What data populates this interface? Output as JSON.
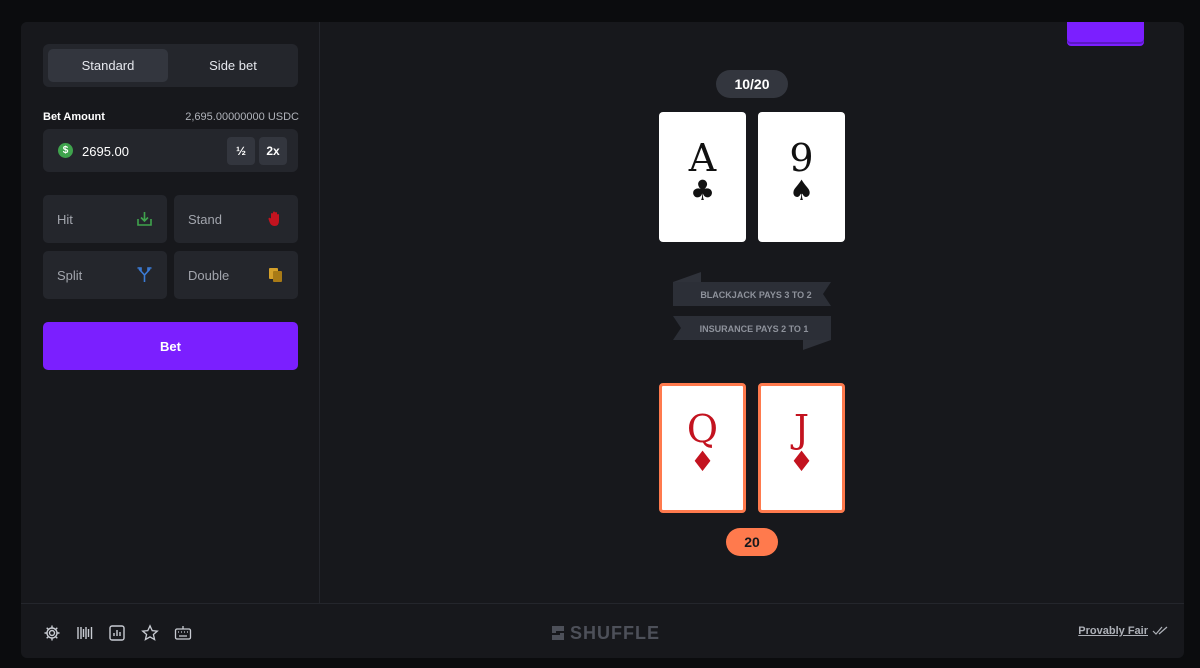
{
  "tabs": {
    "standard": "Standard",
    "side_bet": "Side bet"
  },
  "bet": {
    "label": "Bet Amount",
    "balance": "2,695.00000000 USDC",
    "coin_symbol": "$",
    "value": "2695.00",
    "half": "½",
    "double": "2x"
  },
  "actions": {
    "hit": "Hit",
    "stand": "Stand",
    "split": "Split",
    "double": "Double"
  },
  "bet_button": "Bet",
  "dealer": {
    "score": "10/20",
    "cards": [
      {
        "rank": "A",
        "suit": "♣"
      },
      {
        "rank": "9",
        "suit": "♠"
      }
    ]
  },
  "banners": {
    "line1": "BLACKJACK PAYS 3 TO 2",
    "line2": "INSURANCE PAYS 2 TO 1"
  },
  "player": {
    "score": "20",
    "cards": [
      {
        "rank": "Q",
        "suit": "♦"
      },
      {
        "rank": "J",
        "suit": "♦"
      }
    ]
  },
  "footer": {
    "logo": "SHUFFLE",
    "provably_fair": "Provably Fair",
    "icons": [
      "gear-icon",
      "barcode-icon",
      "stats-icon",
      "star-icon",
      "keyboard-icon"
    ]
  },
  "colors": {
    "accent": "#7b1fff",
    "highlight": "#ff7a4d",
    "hit": "#3fa34d",
    "stand": "#c3131f",
    "split": "#3b7bd6",
    "double": "#d4a02a"
  }
}
